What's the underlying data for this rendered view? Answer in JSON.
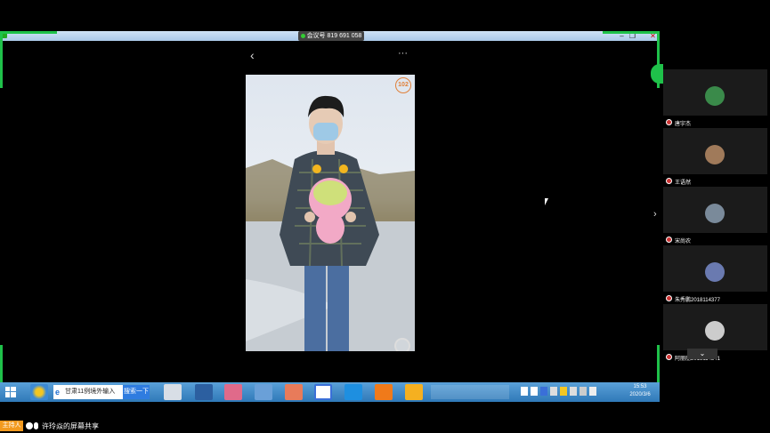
{
  "meeting": {
    "id_text": "会议号 819 691 058"
  },
  "phone": {
    "badge": "102",
    "more_icon": "···"
  },
  "participants": [
    {
      "name": "唐宇杰",
      "avatar_color": "#3a8a4a"
    },
    {
      "name": "王语然",
      "avatar_color": "#a07a5a"
    },
    {
      "name": "宋尚农",
      "avatar_color": "#7a8a9a"
    },
    {
      "name": "朱秀鹏2018114377",
      "avatar_color": "#6a7ab0"
    },
    {
      "name": "阿丽丽2018114341",
      "avatar_color": "#cccccc"
    }
  ],
  "taskbar": {
    "ie_tab": "甘肃11例境外输入",
    "search_button": "搜索一下",
    "time": "15:53",
    "date": "2020/3/6"
  },
  "footer": {
    "host_badge": "主持人",
    "sharing_text": "许玲焱的屏幕共享"
  },
  "colors": {
    "accent_green": "#1fc14a",
    "host_badge": "#f39a1e"
  }
}
